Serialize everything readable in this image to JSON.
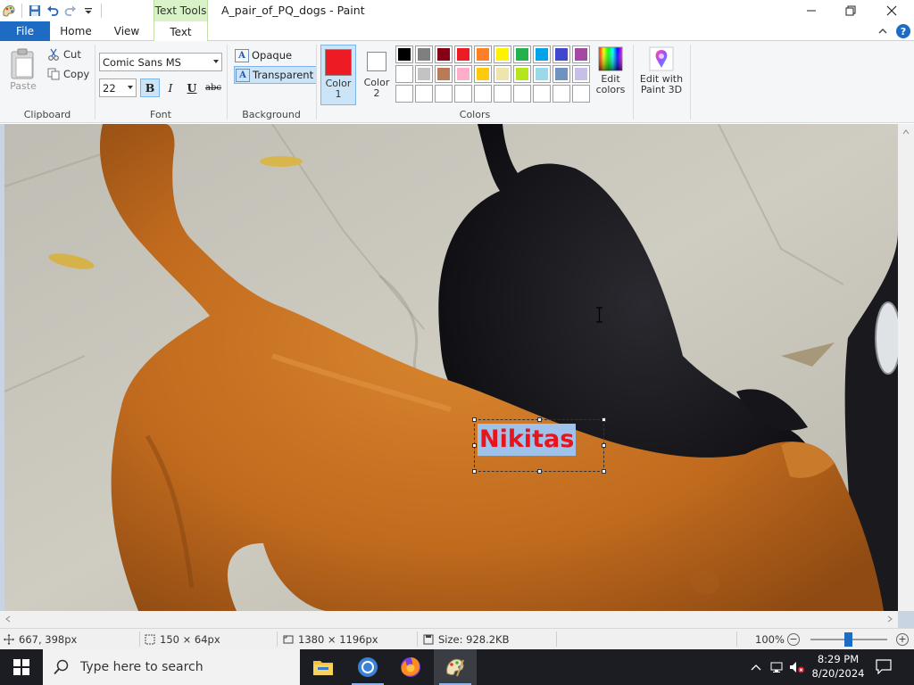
{
  "window": {
    "title": "A_pair_of_PQ_dogs - Paint",
    "contextual_tab": "Text Tools"
  },
  "tabs": {
    "file": "File",
    "home": "Home",
    "view": "View",
    "text": "Text"
  },
  "ribbon": {
    "clipboard": {
      "paste": "Paste",
      "cut": "Cut",
      "copy": "Copy",
      "group": "Clipboard"
    },
    "font": {
      "family": "Comic Sans MS",
      "size": "22",
      "bold": "B",
      "italic": "I",
      "underline": "U",
      "strike": "abc",
      "group": "Font"
    },
    "background": {
      "opaque": "Opaque",
      "transparent": "Transparent",
      "group": "Background"
    },
    "colors": {
      "color1_label": "Color",
      "color1_num": "1",
      "color1_value": "#ed1c24",
      "color2_label": "Color",
      "color2_num": "2",
      "color2_value": "#ffffff",
      "group": "Colors",
      "palette_row1": [
        "#000000",
        "#7f7f7f",
        "#880015",
        "#ed1c24",
        "#ff7f27",
        "#fff200",
        "#22b14c",
        "#00a2e8",
        "#3f48cc",
        "#a349a4"
      ],
      "palette_row2": [
        "#ffffff",
        "#c3c3c3",
        "#b97a57",
        "#ffaec9",
        "#ffc90e",
        "#efe4b0",
        "#b5e61d",
        "#99d9ea",
        "#7092be",
        "#c8bfe7"
      ],
      "edit_colors_line1": "Edit",
      "edit_colors_line2": "colors",
      "edit_paint3d_line1": "Edit with",
      "edit_paint3d_line2": "Paint 3D"
    }
  },
  "canvas": {
    "text_content": "Nikitas"
  },
  "status": {
    "cursor_pos": "667, 398px",
    "selection_size": "150 × 64px",
    "image_size": "1380 × 1196px",
    "file_size": "Size: 928.2KB",
    "zoom": "100%"
  },
  "taskbar": {
    "search_placeholder": "Type here to search",
    "time": "8:29 PM",
    "date": "8/20/2024"
  }
}
